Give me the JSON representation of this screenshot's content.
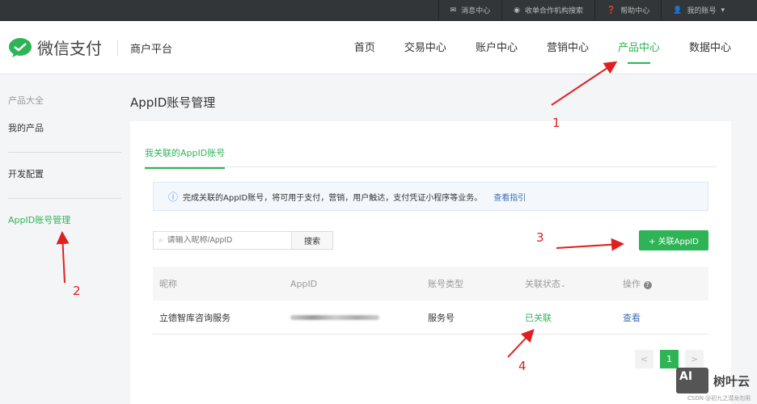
{
  "topbar": {
    "items": [
      {
        "icon": "mail-icon",
        "label": "消息中心"
      },
      {
        "icon": "search-circle-icon",
        "label": "收单合作机构搜索"
      },
      {
        "icon": "help-icon",
        "label": "帮助中心"
      },
      {
        "icon": "user-icon",
        "label": "我的账号"
      }
    ]
  },
  "header": {
    "logo": "微信支付",
    "platform": "商户平台",
    "nav": [
      "首页",
      "交易中心",
      "账户中心",
      "营销中心",
      "产品中心",
      "数据中心"
    ],
    "active_nav": "产品中心"
  },
  "sidebar": {
    "heading": "产品大全",
    "items": [
      "我的产品",
      "开发配置",
      "AppID账号管理"
    ]
  },
  "main": {
    "title": "AppID账号管理",
    "tab": "我关联的AppID账号",
    "notice": {
      "text": "完成关联的AppID账号，将可用于支付，营销，用户触达，支付凭证小程序等业务。",
      "link": "查看指引"
    },
    "search": {
      "placeholder": "请输入昵称/AppID",
      "button": "搜索"
    },
    "add_button": "+ 关联AppID",
    "table": {
      "headers": [
        "昵称",
        "AppID",
        "账号类型",
        "关联状态",
        "操作"
      ],
      "rows": [
        {
          "name": "立德智库咨询服务",
          "type": "服务号",
          "status": "已关联",
          "action": "查看"
        }
      ]
    },
    "pager": {
      "prev": "<",
      "current": "1",
      "next": ">"
    }
  },
  "annotations": [
    "1",
    "2",
    "3",
    "4"
  ],
  "watermark": {
    "logo": "AI",
    "brand": "树叶云",
    "sub": "CSDN @初九之潜龙勿用"
  },
  "colors": {
    "accent": "#2fb357",
    "link": "#3a6fb5",
    "annotation": "#e02020"
  }
}
